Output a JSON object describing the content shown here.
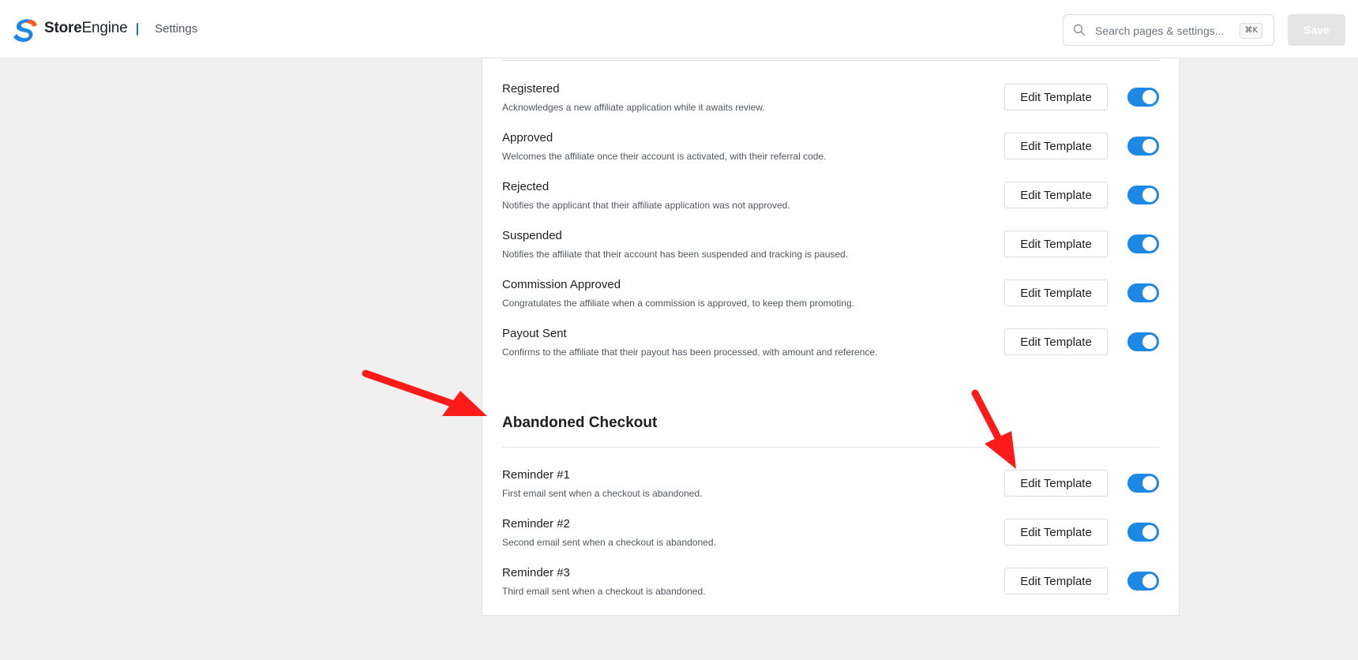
{
  "app": {
    "brand_bold": "Store",
    "brand_regular": "Engine",
    "section": "Settings"
  },
  "search": {
    "placeholder": "Search pages & settings...",
    "shortcut": "⌘K"
  },
  "toolbar": {
    "save_label": "Save"
  },
  "colors": {
    "accent": "#1e88e5",
    "annotation_arrow": "#ff1a1a",
    "logo_blue": "#1e88e5",
    "logo_orange": "#ff5a1f"
  },
  "icons": [
    "storeengine-logo-icon",
    "search-icon",
    "arrow-annotation-icon"
  ],
  "affiliate_emails": [
    {
      "title": "Registered",
      "desc": "Acknowledges a new affiliate application while it awaits review.",
      "button": "Edit Template",
      "enabled": true
    },
    {
      "title": "Approved",
      "desc": "Welcomes the affiliate once their account is activated, with their referral code.",
      "button": "Edit Template",
      "enabled": true
    },
    {
      "title": "Rejected",
      "desc": "Notifies the applicant that their affiliate application was not approved.",
      "button": "Edit Template",
      "enabled": true
    },
    {
      "title": "Suspended",
      "desc": "Notifies the affiliate that their account has been suspended and tracking is paused.",
      "button": "Edit Template",
      "enabled": true
    },
    {
      "title": "Commission Approved",
      "desc": "Congratulates the affiliate when a commission is approved, to keep them promoting.",
      "button": "Edit Template",
      "enabled": true
    },
    {
      "title": "Payout Sent",
      "desc": "Confirms to the affiliate that their payout has been processed, with amount and reference.",
      "button": "Edit Template",
      "enabled": true
    }
  ],
  "abandoned_checkout": {
    "heading": "Abandoned Checkout",
    "items": [
      {
        "title": "Reminder #1",
        "desc": "First email sent when a checkout is abandoned.",
        "button": "Edit Template",
        "enabled": true
      },
      {
        "title": "Reminder #2",
        "desc": "Second email sent when a checkout is abandoned.",
        "button": "Edit Template",
        "enabled": true
      },
      {
        "title": "Reminder #3",
        "desc": "Third email sent when a checkout is abandoned.",
        "button": "Edit Template",
        "enabled": true
      }
    ]
  }
}
